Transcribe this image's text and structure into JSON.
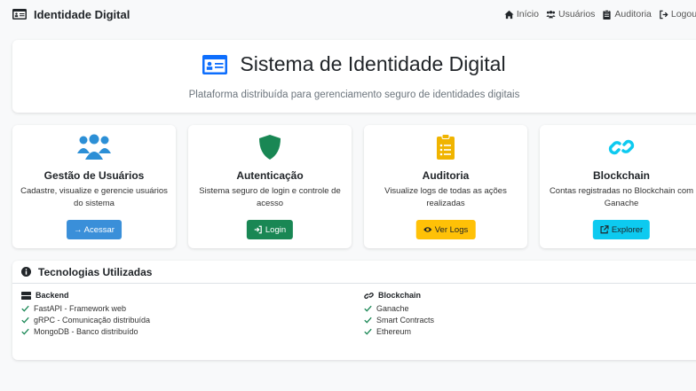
{
  "navbar": {
    "brand": "Identidade Digital",
    "links": [
      {
        "label": "Início",
        "icon": "home-icon"
      },
      {
        "label": "Usuários",
        "icon": "users-icon"
      },
      {
        "label": "Auditoria",
        "icon": "clipboard-icon"
      },
      {
        "label": "Logout",
        "icon": "logout-icon"
      }
    ]
  },
  "hero": {
    "title": "Sistema de Identidade Digital",
    "subtitle": "Plataforma distribuída para gerenciamento seguro de identidades digitais"
  },
  "cards": [
    {
      "title": "Gestão de Usuários",
      "description": "Cadastre, visualize e gerencie usuários do sistema",
      "button": "→ Acessar",
      "icon": "users-icon",
      "icon_color": "#2c8fd6",
      "button_color": "#3a8fd9"
    },
    {
      "title": "Autenticação",
      "description": "Sistema seguro de login e controle de acesso",
      "button": "Login",
      "icon": "shield-icon",
      "icon_color": "#198754",
      "button_color": "#198754"
    },
    {
      "title": "Auditoria",
      "description": "Visualize logs de todas as ações realizadas",
      "button": "Ver Logs",
      "icon": "clipboard-list-icon",
      "icon_color": "#f0b400",
      "button_color": "#ffc107"
    },
    {
      "title": "Blockchain",
      "description": "Contas registradas no Blockchain com Ganache",
      "button": "Explorer",
      "icon": "link-icon",
      "icon_color": "#0dcaf0",
      "button_color": "#0dcaf0"
    }
  ],
  "tech": {
    "title": "Tecnologias Utilizadas",
    "backend": {
      "title": "Backend",
      "items": [
        "FastAPI - Framework web",
        "gRPC - Comunicação distribuída",
        "MongoDB - Banco distribuído"
      ]
    },
    "blockchain": {
      "title": "Blockchain",
      "items": [
        "Ganache",
        "Smart Contracts",
        "Ethereum"
      ]
    }
  }
}
